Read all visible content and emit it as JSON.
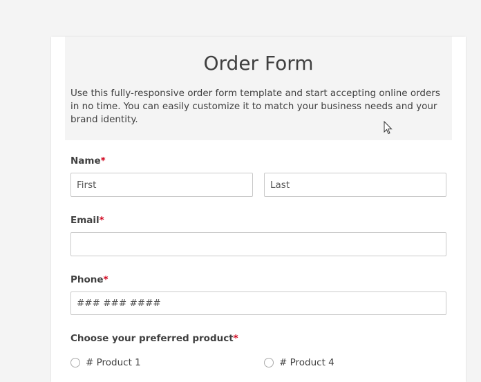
{
  "form": {
    "title": "Order Form",
    "description": "Use this fully-responsive order form template and start accepting online orders in no time. You can easily customize it to match your business needs and your brand identity.",
    "required_mark": "*",
    "name": {
      "label": "Name",
      "first_placeholder": "First",
      "last_placeholder": "Last"
    },
    "email": {
      "label": "Email",
      "value": ""
    },
    "phone": {
      "label": "Phone",
      "placeholder": "### ### ####"
    },
    "product": {
      "label": "Choose your preferred product",
      "options": [
        "# Product 1",
        "# Product 4"
      ]
    }
  },
  "colors": {
    "required": "#d0021b",
    "header_bg": "#f4f4f4",
    "page_bg": "#f4f4f4"
  }
}
